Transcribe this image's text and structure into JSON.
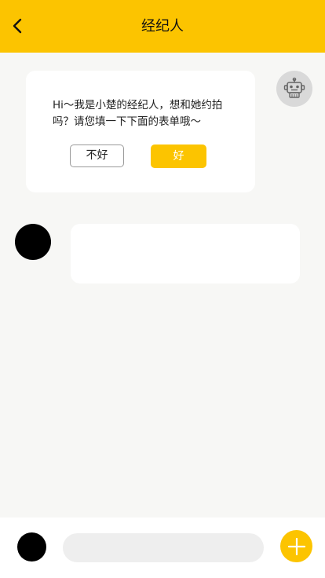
{
  "header": {
    "title": "经纪人",
    "back_icon": "chevron-left-icon"
  },
  "bot_message": {
    "avatar_icon": "robot-icon",
    "text": "Hi～我是小楚的经纪人，想和她约拍吗？请您填一下下面的表单哦～",
    "no_label": "不好",
    "yes_label": "好"
  },
  "user_message": {
    "text": ""
  },
  "composer": {
    "input_value": "",
    "input_placeholder": "",
    "plus_icon": "plus-icon"
  },
  "colors": {
    "accent": "#fcc400",
    "background": "#f7f7f5",
    "bubble": "#ffffff",
    "input_bg": "#eeeeee",
    "robot_avatar_bg": "#d9d9d9"
  }
}
